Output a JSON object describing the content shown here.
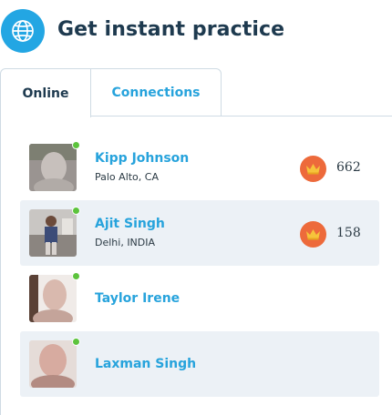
{
  "header": {
    "title": "Get instant practice",
    "icon": "globe-icon"
  },
  "tabs": [
    {
      "label": "Online",
      "active": true
    },
    {
      "label": "Connections",
      "active": false
    }
  ],
  "users": [
    {
      "name": "Kipp Johnson",
      "location": "Palo Alto, CA",
      "score": "662",
      "online": true
    },
    {
      "name": "Ajit Singh",
      "location": "Delhi, INDIA",
      "score": "158",
      "online": true
    },
    {
      "name": "Taylor Irene",
      "location": "",
      "score": "",
      "online": true
    },
    {
      "name": "Laxman Singh",
      "location": "",
      "score": "",
      "online": true
    }
  ],
  "colors": {
    "accent": "#27a3dc",
    "badge": "#ed6a3b",
    "online": "#5cc33c",
    "row_alt": "#ecf1f6"
  }
}
